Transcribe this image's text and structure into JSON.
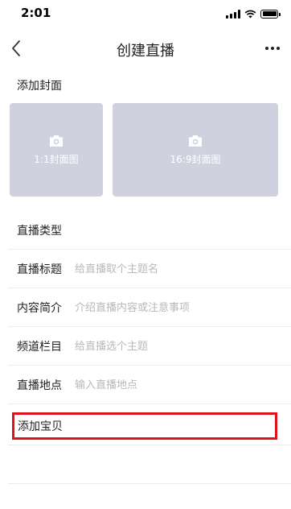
{
  "status": {
    "time": "2:01"
  },
  "nav": {
    "title": "创建直播"
  },
  "cover": {
    "label": "添加封面",
    "options": [
      "1:1封面图",
      "16:9封面图"
    ]
  },
  "form": {
    "type_label": "直播类型",
    "title_label": "直播标题",
    "title_placeholder": "给直播取个主题名",
    "intro_label": "内容简介",
    "intro_placeholder": "介绍直播内容或注意事项",
    "channel_label": "频道栏目",
    "channel_placeholder": "给直播选个主题",
    "location_label": "直播地点",
    "location_placeholder": "输入直播地点",
    "product_label": "添加宝贝"
  },
  "colors": {
    "highlight": "#e0131d",
    "cover_bg": "#cfd2de",
    "placeholder": "#b8b8b8"
  },
  "icons": [
    "back-chevron-icon",
    "more-dots-icon",
    "camera-icon",
    "signal-icon",
    "wifi-icon",
    "battery-icon"
  ]
}
